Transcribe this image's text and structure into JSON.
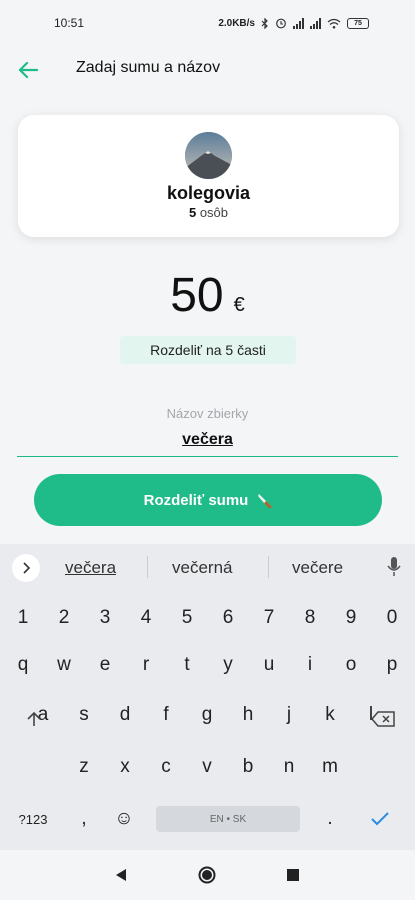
{
  "status": {
    "time": "10:51",
    "network_speed": "2.0KB/s",
    "battery": "75",
    "icons": [
      "bluetooth-icon",
      "alarm-icon",
      "cell-signal-icon",
      "cell-signal-icon",
      "wifi-icon",
      "battery-icon"
    ]
  },
  "header": {
    "title": "Zadaj sumu a názov",
    "back_icon": "arrow-left-icon"
  },
  "group": {
    "name": "kolegovia",
    "count": "5",
    "count_unit": "osôb"
  },
  "amount": {
    "value": "50",
    "currency": "€"
  },
  "split_badge": "Rozdeliť na 5 časti",
  "name_field": {
    "label": "Názov zbierky",
    "value": "večera"
  },
  "split_button": {
    "label": "Rozdeliť sumu",
    "icon": "knife-icon"
  },
  "keyboard": {
    "suggestions": [
      "večera",
      "večerná",
      "večere"
    ],
    "row_numbers": [
      "1",
      "2",
      "3",
      "4",
      "5",
      "6",
      "7",
      "8",
      "9",
      "0"
    ],
    "row_1": [
      "q",
      "w",
      "e",
      "r",
      "t",
      "y",
      "u",
      "i",
      "o",
      "p"
    ],
    "row_2": [
      "a",
      "s",
      "d",
      "f",
      "g",
      "h",
      "j",
      "k",
      "l"
    ],
    "row_3": [
      "z",
      "x",
      "c",
      "v",
      "b",
      "n",
      "m"
    ],
    "symbols_label": "?123",
    "comma": ",",
    "emoji": "☺",
    "space_label": "EN • SK",
    "period": "."
  },
  "colors": {
    "accent": "#1fbb88",
    "badge_bg": "#e2f5ee",
    "underline": "#1cb888"
  }
}
